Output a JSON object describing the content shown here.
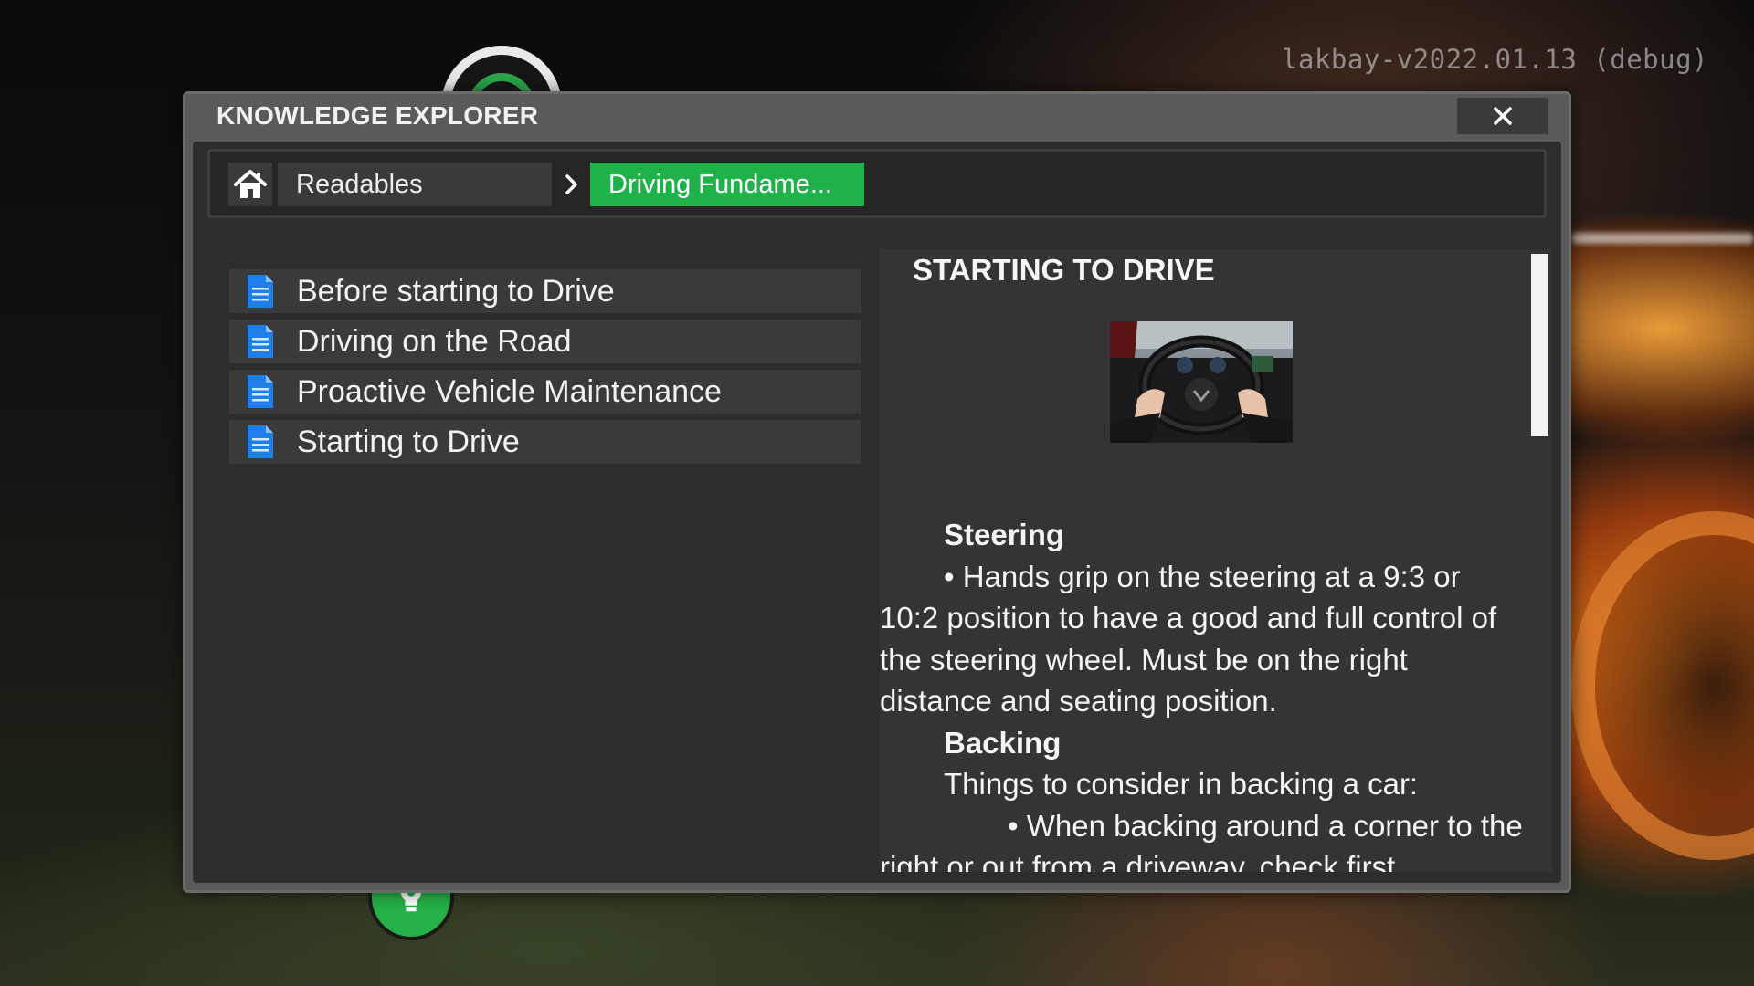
{
  "debug_label": "lakbay-v2022.01.13 (debug)",
  "window": {
    "title": "KNOWLEDGE EXPLORER",
    "close_icon": "close-icon"
  },
  "breadcrumb": {
    "home_icon": "home-icon",
    "items": [
      "Readables",
      "Driving Fundame..."
    ],
    "separator_icon": "chevron-right-icon",
    "active_color": "#20b24a"
  },
  "articles": [
    {
      "label": "Before starting to Drive",
      "icon": "document-icon"
    },
    {
      "label": "Driving on the Road",
      "icon": "document-icon"
    },
    {
      "label": "Proactive Vehicle Maintenance",
      "icon": "document-icon"
    },
    {
      "label": "Starting to Drive",
      "icon": "document-icon"
    }
  ],
  "reader": {
    "title": "STARTING TO DRIVE",
    "image_subject": "hands-on-steering-wheel",
    "sections": {
      "steering_heading": "Steering",
      "steering_text": "• Hands grip on the steering at a 9:3 or 10:2 position to have a good and full control of the steering wheel. Must be on the right distance and seating position.",
      "backing_heading": "Backing",
      "backing_intro": "Things to consider in backing a car:",
      "backing_bullet": "• When backing around a corner to the right or out from a driveway, check first"
    }
  },
  "colors": {
    "window_frame": "#5a5a5a",
    "panel_bg": "#2d2d2d",
    "item_bg": "#3a3a3a",
    "doc_icon": "#1e7fe8"
  }
}
